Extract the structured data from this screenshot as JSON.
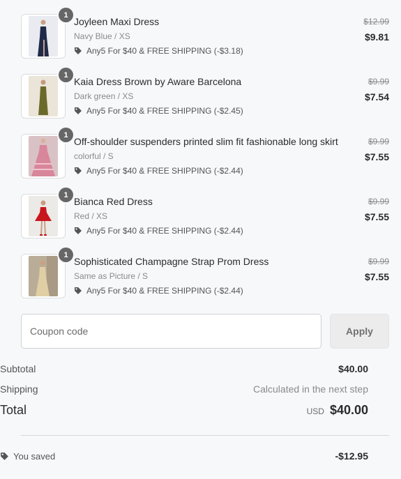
{
  "items": [
    {
      "quantity": "1",
      "name": "Joyleen Maxi Dress",
      "variant": "Navy Blue / XS",
      "discount": "Any5 For $40 & FREE SHIPPING (-$3.18)",
      "original_price": "$12.99",
      "price": "$9.81",
      "image_colors": {
        "bg": "#e9ebf0",
        "dress": "#1f2a4a",
        "skin": "#c99e84"
      }
    },
    {
      "quantity": "1",
      "name": "Kaia Dress Brown by Aware Barcelona",
      "variant": "Dark green / XS",
      "discount": "Any5 For $40 & FREE SHIPPING (-$2.45)",
      "original_price": "$9.99",
      "price": "$7.54",
      "image_colors": {
        "bg": "#ebe4d8",
        "dress": "#6b6a2b",
        "skin": "#c49a7c"
      }
    },
    {
      "quantity": "1",
      "name": "Off-shoulder suspenders printed slim fit fashionable long skirt",
      "variant": "colorful / S",
      "discount": "Any5 For $40 & FREE SHIPPING (-$2.44)",
      "original_price": "$9.99",
      "price": "$7.55",
      "image_colors": {
        "bg": "#d9c2c6",
        "dress": "#d8869a",
        "skin": "#d7b39c"
      }
    },
    {
      "quantity": "1",
      "name": "Bianca Red Dress",
      "variant": "Red / XS",
      "discount": "Any5 For $40 & FREE SHIPPING (-$2.44)",
      "original_price": "$9.99",
      "price": "$7.55",
      "image_colors": {
        "bg": "#eceae6",
        "dress": "#c8161e",
        "skin": "#c89c82"
      }
    },
    {
      "quantity": "1",
      "name": "Sophisticated Champagne Strap Prom Dress",
      "variant": "Same as Picture / S",
      "discount": "Any5 For $40 & FREE SHIPPING (-$2.44)",
      "original_price": "$9.99",
      "price": "$7.55",
      "image_colors": {
        "bg": "#b9ad98",
        "dress": "#e0cfa4",
        "skin": "#caa083"
      }
    }
  ],
  "coupon": {
    "placeholder": "Coupon code",
    "value": "",
    "apply_label": "Apply"
  },
  "summary": {
    "subtotal_label": "Subtotal",
    "subtotal_value": "$40.00",
    "shipping_label": "Shipping",
    "shipping_value": "Calculated in the next step",
    "total_label": "Total",
    "total_currency": "USD",
    "total_value": "$40.00",
    "saved_label": "You saved",
    "saved_value": "-$12.95"
  },
  "icons": {
    "discount": "tag-icon",
    "saved": "tag-icon"
  },
  "colors": {
    "background": "#f7f8fa",
    "qty_badge": "#666666",
    "muted_text": "#8a8a8a"
  }
}
